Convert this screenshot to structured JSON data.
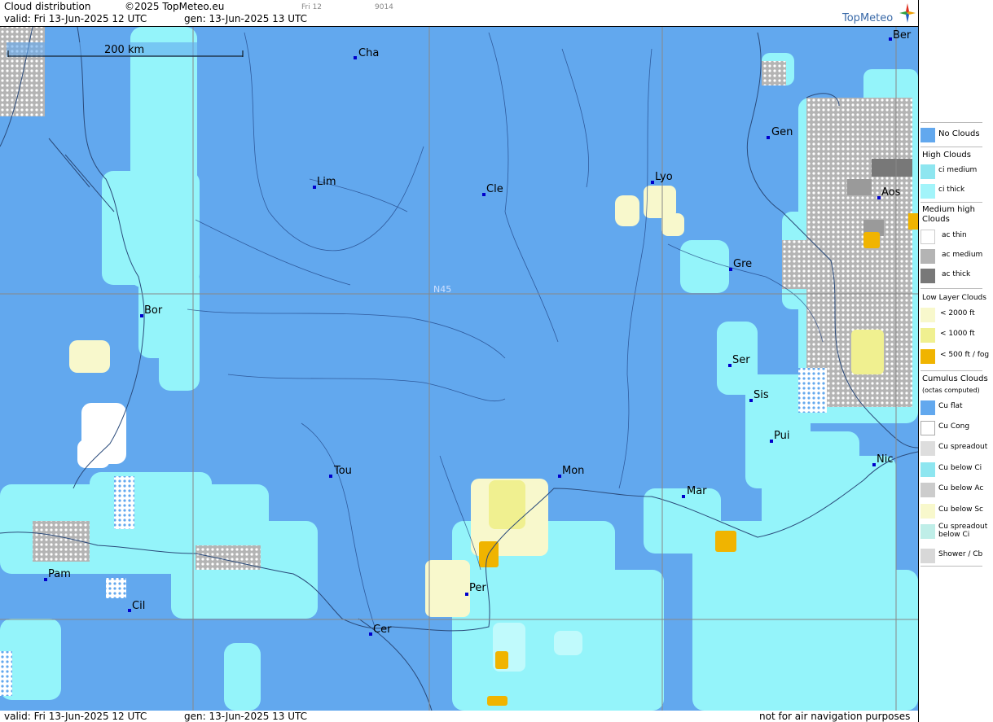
{
  "header": {
    "title": "Cloud distribution",
    "copyright": "©2025 TopMeteo.eu",
    "valid": "valid:  Fri  13-Jun-2025  12 UTC",
    "generated": "gen: 13-Jun-2025 13 UTC",
    "small_1": "Fri 12",
    "small_2": "9014",
    "logo_text": "TopMeteo"
  },
  "map": {
    "scale_label": "200 km",
    "latitude_label": "N45",
    "cities": [
      {
        "label": "Cha",
        "name": "city-cha"
      },
      {
        "label": "Ber",
        "name": "city-ber"
      },
      {
        "label": "Gen",
        "name": "city-gen"
      },
      {
        "label": "Lim",
        "name": "city-lim"
      },
      {
        "label": "Cle",
        "name": "city-cle"
      },
      {
        "label": "Lyo",
        "name": "city-lyo"
      },
      {
        "label": "Aos",
        "name": "city-aos"
      },
      {
        "label": "Gre",
        "name": "city-gre"
      },
      {
        "label": "Bor",
        "name": "city-bor"
      },
      {
        "label": "Ser",
        "name": "city-ser"
      },
      {
        "label": "Sis",
        "name": "city-sis"
      },
      {
        "label": "Pui",
        "name": "city-pui"
      },
      {
        "label": "Tou",
        "name": "city-tou"
      },
      {
        "label": "Mon",
        "name": "city-mon"
      },
      {
        "label": "Mar",
        "name": "city-mar"
      },
      {
        "label": "Nic",
        "name": "city-nic"
      },
      {
        "label": "Pam",
        "name": "city-pam"
      },
      {
        "label": "Cil",
        "name": "city-cil"
      },
      {
        "label": "Per",
        "name": "city-per"
      },
      {
        "label": "Cer",
        "name": "city-cer"
      }
    ],
    "colors": {
      "no_clouds": "#62a8ee",
      "ci_medium": "#8ee6f0",
      "ci_thick": "#a2f4fa",
      "low_2000": "#f8f8cc",
      "low_1000": "#f0f090",
      "low_500": "#f0b400",
      "ac_thin": "#ffffff",
      "ac_medium": "#b4b4b4",
      "ac_thick": "#787878"
    }
  },
  "legend": {
    "items": [
      {
        "type": "swatch",
        "label": "No Clouds",
        "color": "#62a8ee"
      },
      {
        "type": "header",
        "label": "High Clouds"
      },
      {
        "type": "swatch",
        "label": "ci medium",
        "color": "#8ee6f0"
      },
      {
        "type": "swatch",
        "label": "ci thick",
        "color": "#a2f4fa"
      },
      {
        "type": "header",
        "label": "Medium high Clouds"
      },
      {
        "type": "swatch",
        "label": "ac thin",
        "color": "#ffffff"
      },
      {
        "type": "swatch",
        "label": "ac medium",
        "color": "#b4b4b4"
      },
      {
        "type": "swatch",
        "label": "ac thick",
        "color": "#787878"
      },
      {
        "type": "header",
        "label": "Low Layer Clouds"
      },
      {
        "type": "swatch",
        "label": "< 2000 ft",
        "color": "#f8f8cc"
      },
      {
        "type": "swatch",
        "label": "< 1000 ft",
        "color": "#f0f090"
      },
      {
        "type": "swatch",
        "label": "< 500 ft / fog",
        "color": "#f0b400"
      },
      {
        "type": "header",
        "label": "Cumulus Clouds"
      },
      {
        "type": "sub",
        "label": "(octas computed)"
      },
      {
        "type": "swatch",
        "label": "Cu flat",
        "color": "#62a8ee"
      },
      {
        "type": "swatch",
        "label": "Cu Cong",
        "color": "#ffffff"
      },
      {
        "type": "swatch",
        "label": "Cu spreadout",
        "color": "#dddddd"
      },
      {
        "type": "swatch",
        "label": "Cu below Ci",
        "color": "#8ee6f0"
      },
      {
        "type": "swatch",
        "label": "Cu below Ac",
        "color": "#cccccc"
      },
      {
        "type": "swatch",
        "label": "Cu below Sc",
        "color": "#f8f8cc"
      },
      {
        "type": "swatch",
        "label": "Cu spreadout below Ci",
        "color": "#bfeee8"
      },
      {
        "type": "swatch",
        "label": "Shower / Cb",
        "color": "#d8d8d8"
      }
    ]
  },
  "footer": {
    "valid": "valid:  Fri  13-Jun-2025  12 UTC",
    "generated": "gen: 13-Jun-2025 13 UTC",
    "disclaimer": "not for air navigation purposes"
  }
}
